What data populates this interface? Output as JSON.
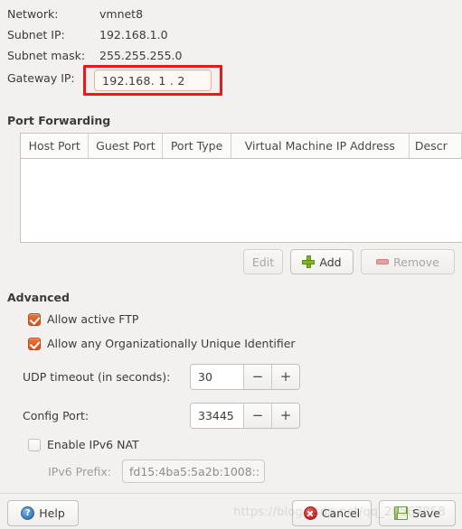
{
  "network_info": {
    "rows": [
      {
        "label": "Network:",
        "value": "vmnet8"
      },
      {
        "label": "Subnet IP:",
        "value": "192.168.1.0"
      },
      {
        "label": "Subnet mask:",
        "value": "255.255.255.0"
      }
    ]
  },
  "gateway": {
    "label": "Gateway IP:",
    "value": "192.168.  1  .  2",
    "highlight_color": "#e8191b",
    "focus_border_color": "#e8b48f"
  },
  "port_forwarding": {
    "title": "Port Forwarding",
    "columns": [
      "Host Port",
      "Guest Port",
      "Port Type",
      "Virtual Machine IP Address",
      "Descr"
    ],
    "rows": [],
    "buttons": {
      "edit": "Edit",
      "add": "Add",
      "remove": "Remove"
    }
  },
  "advanced": {
    "title": "Advanced",
    "checkboxes": [
      {
        "label": "Allow active FTP",
        "checked": true
      },
      {
        "label": "Allow any Organizationally Unique Identifier",
        "checked": true
      },
      {
        "label": "Enable IPv6 NAT",
        "checked": false
      }
    ],
    "udp_timeout": {
      "label": "UDP timeout (in seconds):",
      "value": "30",
      "decrement": "−",
      "increment": "+"
    },
    "config_port": {
      "label": "Config Port:",
      "value": "33445",
      "decrement": "−",
      "increment": "+"
    },
    "ipv6_prefix": {
      "label": "IPv6 Prefix:",
      "value": "fd15:4ba5:5a2b:1008::"
    }
  },
  "footer": {
    "help": "Help",
    "cancel": "Cancel",
    "save": "Save",
    "help_glyph": "?"
  },
  "watermark": {
    "text": "https://blog.csdn.net/qq_20567858"
  },
  "colors": {
    "background": "#f2f1f0",
    "accent_orange": "#d95520",
    "annotation_red": "#e8191b",
    "text": "#3c3b37"
  }
}
